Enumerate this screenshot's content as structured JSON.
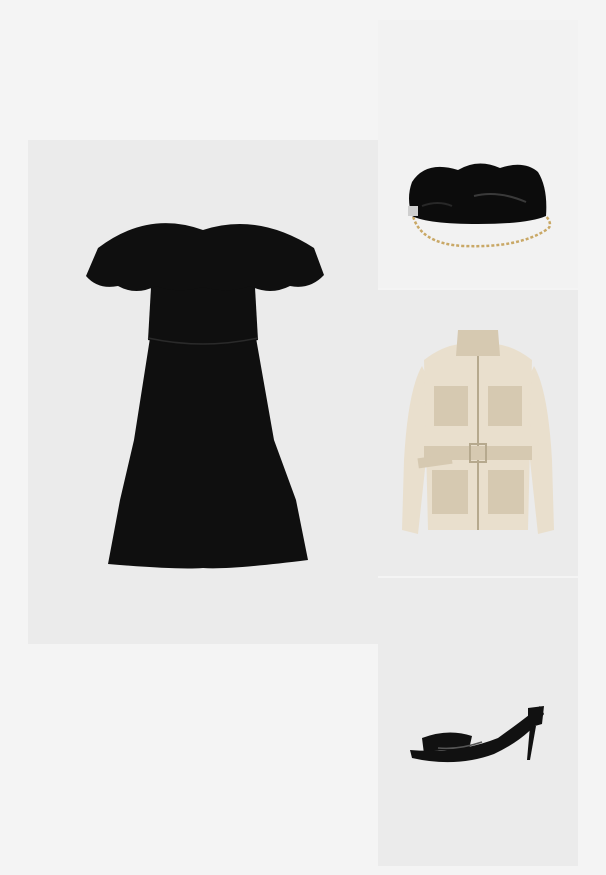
{
  "board": {
    "colors": {
      "page_bg": "#f4f4f4",
      "tile_bg": "#ebebeb",
      "tile_bg_light": "#f2f2f2",
      "dress": "#0f0f0f",
      "bag": "#0c0c0c",
      "bag_chain": "#c9a866",
      "jacket": "#e9dfcd",
      "jacket_shade": "#d6c9b1",
      "jacket_hardware": "#b6a98e",
      "heels": "#111111"
    },
    "items": [
      {
        "id": "dress",
        "name": "off-shoulder-black-dress"
      },
      {
        "id": "bag",
        "name": "black-patent-clutch-bag"
      },
      {
        "id": "jacket",
        "name": "beige-belted-field-jacket"
      },
      {
        "id": "heels",
        "name": "black-patent-mule-heels"
      }
    ]
  }
}
